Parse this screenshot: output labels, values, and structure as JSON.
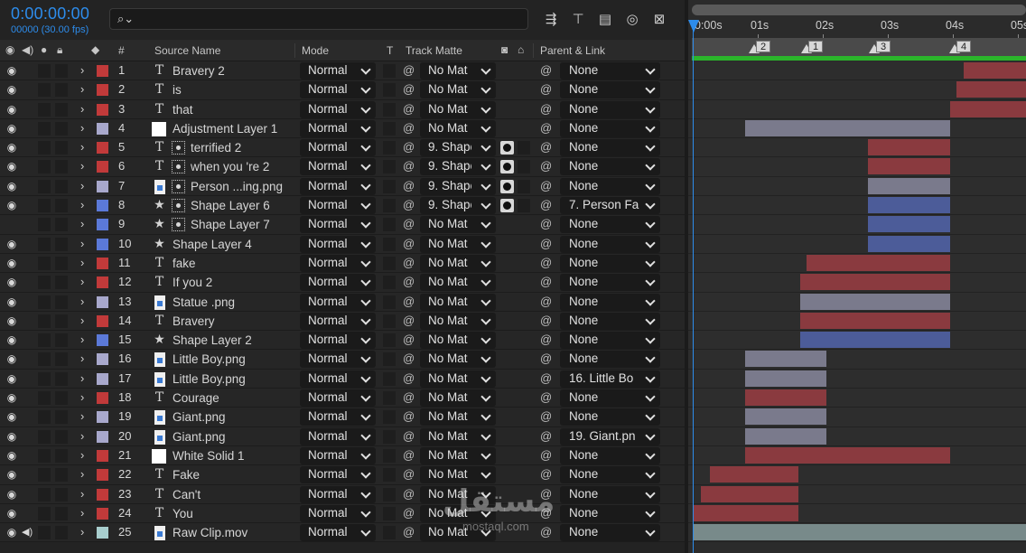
{
  "header": {
    "timecode": "0:00:00:00",
    "frames": "00000 (30.00 fps)",
    "search_placeholder": ""
  },
  "columns": {
    "num": "#",
    "source_name": "Source Name",
    "mode": "Mode",
    "t": "T",
    "track_matte": "Track Matte",
    "parent_link": "Parent & Link"
  },
  "timeline": {
    "ticks": [
      "0:00s",
      "01s",
      "02s",
      "03s",
      "04s",
      "05s"
    ],
    "markers": [
      "2",
      "1",
      "3",
      "4"
    ]
  },
  "colors": {
    "red": "#c13a3a",
    "lavender": "#a8a8cc",
    "blue": "#5b79d8",
    "teal": "#a8cece",
    "bar_red": "#8a3a3f",
    "bar_gray": "#7a7a8c",
    "bar_blue": "#4c5c99",
    "bar_teal": "#788a8a",
    "accent": "#2d8ceb"
  },
  "layers": [
    {
      "num": "1",
      "name": "Bravery 2",
      "type": "text",
      "label": "red",
      "mode": "Normal",
      "matte": "No Mat",
      "parent": "None",
      "eye": true,
      "bar": "red",
      "start": 4.16,
      "end": 5.2
    },
    {
      "num": "2",
      "name": "is",
      "type": "text",
      "label": "red",
      "mode": "Normal",
      "matte": "No Mat",
      "parent": "None",
      "eye": true,
      "bar": "red",
      "start": 4.05,
      "end": 5.2
    },
    {
      "num": "3",
      "name": "that",
      "type": "text",
      "label": "red",
      "mode": "Normal",
      "matte": "No Mat",
      "parent": "None",
      "eye": true,
      "bar": "red",
      "start": 3.96,
      "end": 5.2
    },
    {
      "num": "4",
      "name": "Adjustment Layer 1",
      "type": "solid",
      "label": "lavender",
      "mode": "Normal",
      "matte": "No Mat",
      "parent": "None",
      "eye": true,
      "bar": "gray",
      "start": 0.81,
      "end": 3.96
    },
    {
      "num": "5",
      "name": "terrified 2",
      "type": "text",
      "label": "red",
      "mode": "Normal",
      "matte": "9. Shape",
      "parent": "None",
      "eye": true,
      "bar": "red",
      "start": 2.7,
      "end": 3.96,
      "mask": true,
      "tmask": true
    },
    {
      "num": "6",
      "name": "when you 're 2",
      "type": "text",
      "label": "red",
      "mode": "Normal",
      "matte": "9. Shape",
      "parent": "None",
      "eye": true,
      "bar": "red",
      "start": 2.7,
      "end": 3.96,
      "mask": true,
      "tmask": true
    },
    {
      "num": "7",
      "name": "Person ...ing.png",
      "type": "file",
      "label": "lavender",
      "mode": "Normal",
      "matte": "9. Shape",
      "parent": "None",
      "eye": true,
      "bar": "gray",
      "start": 2.7,
      "end": 3.96,
      "mask": true,
      "tmask": true
    },
    {
      "num": "8",
      "name": "Shape Layer 6",
      "type": "shape",
      "label": "blue",
      "mode": "Normal",
      "matte": "9. Shape",
      "parent": "7. Person Fa",
      "eye": true,
      "bar": "blue",
      "start": 2.7,
      "end": 3.96,
      "mask": true,
      "tmask": true
    },
    {
      "num": "9",
      "name": "Shape Layer 7",
      "type": "shape",
      "label": "blue",
      "mode": "Normal",
      "matte": "No Mat",
      "parent": "None",
      "eye": false,
      "bar": "blue",
      "start": 2.7,
      "end": 3.96,
      "mask": true
    },
    {
      "num": "10",
      "name": "Shape Layer 4",
      "type": "shape",
      "label": "blue",
      "mode": "Normal",
      "matte": "No Mat",
      "parent": "None",
      "eye": true,
      "bar": "blue",
      "start": 2.7,
      "end": 3.96
    },
    {
      "num": "11",
      "name": "fake",
      "type": "text",
      "label": "red",
      "mode": "Normal",
      "matte": "No Mat",
      "parent": "None",
      "eye": true,
      "bar": "red",
      "start": 1.75,
      "end": 3.96
    },
    {
      "num": "12",
      "name": "If you 2",
      "type": "text",
      "label": "red",
      "mode": "Normal",
      "matte": "No Mat",
      "parent": "None",
      "eye": true,
      "bar": "red",
      "start": 1.65,
      "end": 3.96
    },
    {
      "num": "13",
      "name": "Statue .png",
      "type": "file",
      "label": "lavender",
      "mode": "Normal",
      "matte": "No Mat",
      "parent": "None",
      "eye": true,
      "bar": "gray",
      "start": 1.65,
      "end": 3.96
    },
    {
      "num": "14",
      "name": "Bravery",
      "type": "text",
      "label": "red",
      "mode": "Normal",
      "matte": "No Mat",
      "parent": "None",
      "eye": true,
      "bar": "red",
      "start": 1.65,
      "end": 3.96
    },
    {
      "num": "15",
      "name": "Shape Layer 2",
      "type": "shape",
      "label": "blue",
      "mode": "Normal",
      "matte": "No Mat",
      "parent": "None",
      "eye": true,
      "bar": "blue",
      "start": 1.65,
      "end": 3.96
    },
    {
      "num": "16",
      "name": "Little Boy.png",
      "type": "file",
      "label": "lavender",
      "mode": "Normal",
      "matte": "No Mat",
      "parent": "None",
      "eye": true,
      "bar": "gray",
      "start": 0.81,
      "end": 2.05
    },
    {
      "num": "17",
      "name": "Little Boy.png",
      "type": "file",
      "label": "lavender",
      "mode": "Normal",
      "matte": "No Mat",
      "parent": "16. Little Bo",
      "eye": true,
      "bar": "gray",
      "start": 0.81,
      "end": 2.05
    },
    {
      "num": "18",
      "name": "Courage",
      "type": "text",
      "label": "red",
      "mode": "Normal",
      "matte": "No Mat",
      "parent": "None",
      "eye": true,
      "bar": "red",
      "start": 0.81,
      "end": 2.05
    },
    {
      "num": "19",
      "name": "Giant.png",
      "type": "file",
      "label": "lavender",
      "mode": "Normal",
      "matte": "No Mat",
      "parent": "None",
      "eye": true,
      "bar": "gray",
      "start": 0.81,
      "end": 2.05
    },
    {
      "num": "20",
      "name": "Giant.png",
      "type": "file",
      "label": "lavender",
      "mode": "Normal",
      "matte": "No Mat",
      "parent": "19. Giant.pn",
      "eye": true,
      "bar": "gray",
      "start": 0.81,
      "end": 2.05
    },
    {
      "num": "21",
      "name": "White Solid 1",
      "type": "solid",
      "label": "red",
      "mode": "Normal",
      "matte": "No Mat",
      "parent": "None",
      "eye": true,
      "bar": "red",
      "start": 0.81,
      "end": 3.96
    },
    {
      "num": "22",
      "name": "Fake",
      "type": "text",
      "label": "red",
      "mode": "Normal",
      "matte": "No Mat",
      "parent": "None",
      "eye": true,
      "bar": "red",
      "start": 0.27,
      "end": 1.63
    },
    {
      "num": "23",
      "name": "Can't",
      "type": "text",
      "label": "red",
      "mode": "Normal",
      "matte": "No Mat",
      "parent": "None",
      "eye": true,
      "bar": "red",
      "start": 0.12,
      "end": 1.63
    },
    {
      "num": "24",
      "name": "You",
      "type": "text",
      "label": "red",
      "mode": "Normal",
      "matte": "No Mat",
      "parent": "None",
      "eye": true,
      "bar": "red",
      "start": 0.0,
      "end": 1.63
    },
    {
      "num": "25",
      "name": "Raw Clip.mov",
      "type": "movie",
      "label": "teal",
      "mode": "Normal",
      "matte": "No Mat",
      "parent": "None",
      "eye": true,
      "audio": true,
      "bar": "teal",
      "start": 0.0,
      "end": 5.2
    }
  ],
  "watermark": {
    "title": "مستقل",
    "sub": "mostaql.com"
  }
}
